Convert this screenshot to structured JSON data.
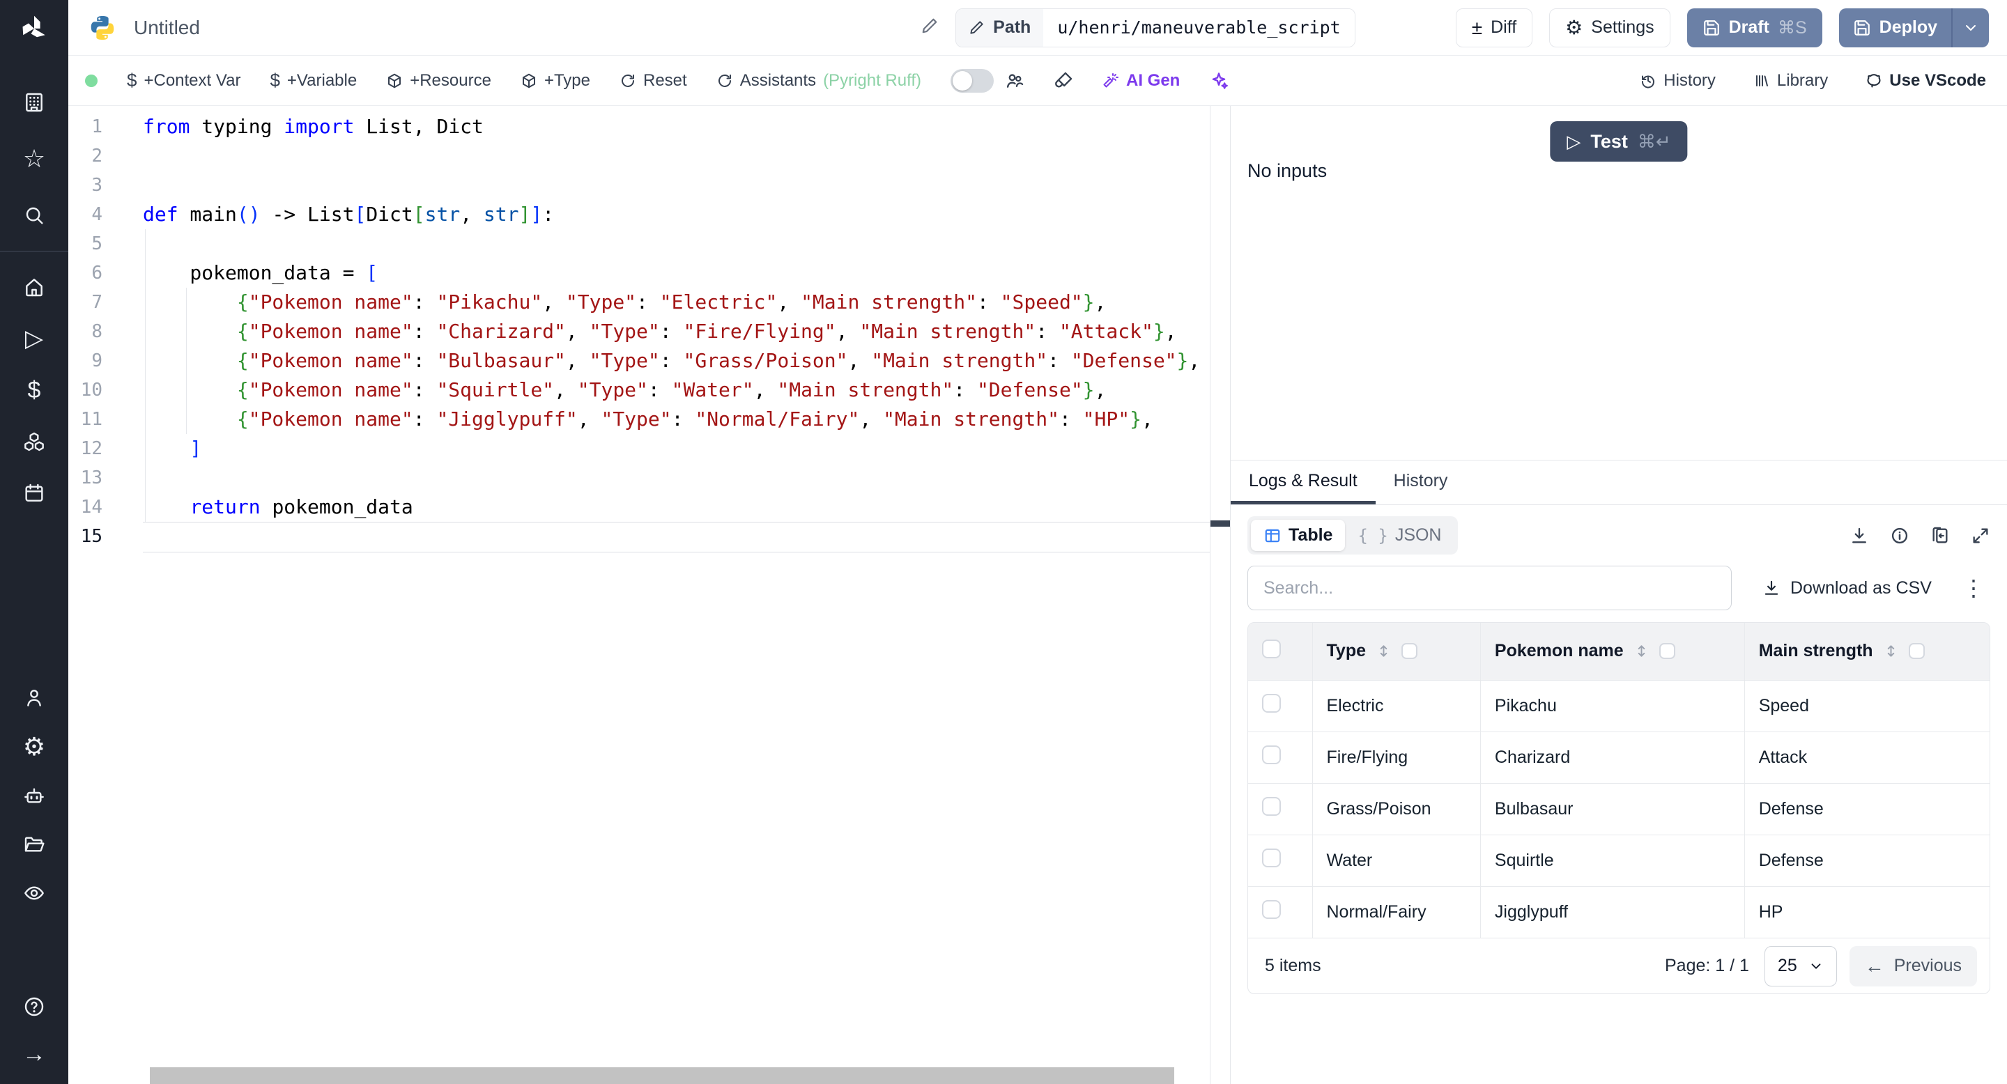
{
  "topbar": {
    "title": "Untitled",
    "path_label": "Path",
    "path_value": "u/henri/maneuverable_script",
    "diff_label": "Diff",
    "settings_label": "Settings",
    "draft_label": "Draft",
    "draft_shortcut": "⌘S",
    "deploy_label": "Deploy"
  },
  "toolbar": {
    "context_var": "+Context Var",
    "variable": "+Variable",
    "resource": "+Resource",
    "type": "+Type",
    "reset": "Reset",
    "assistants": "Assistants",
    "assistants_detail": "(Pyright Ruff)",
    "ai_gen": "AI Gen",
    "history": "History",
    "library": "Library",
    "vscode": "Use VScode"
  },
  "icons": {
    "plus_minus": "±",
    "gear": "⚙",
    "dollar": "$",
    "star": "☆",
    "play": "▷",
    "arrow_right": "→",
    "arrow_left": "←",
    "kebab": "⋮",
    "braces": "{ }",
    "cmd_enter": "⌘↵"
  },
  "editor": {
    "active_line": 15,
    "lines": [
      [
        [
          "kw",
          "from"
        ],
        [
          "pl",
          " typing "
        ],
        [
          "kw",
          "import"
        ],
        [
          "pl",
          " List, Dict"
        ]
      ],
      [],
      [],
      [
        [
          "kw",
          "def"
        ],
        [
          "pl",
          " main"
        ],
        [
          "b1",
          "()"
        ],
        [
          "pl",
          " -> List"
        ],
        [
          "b1",
          "["
        ],
        [
          "pl",
          "Dict"
        ],
        [
          "b2",
          "["
        ],
        [
          "ty",
          "str"
        ],
        [
          "pl",
          ", "
        ],
        [
          "ty",
          "str"
        ],
        [
          "b2",
          "]"
        ],
        [
          "b1",
          "]"
        ],
        [
          "pl",
          ":"
        ]
      ],
      [],
      [
        [
          "pl",
          "    pokemon_data = "
        ],
        [
          "b1",
          "["
        ]
      ],
      [
        [
          "pl",
          "        "
        ],
        [
          "b2",
          "{"
        ],
        [
          "st",
          "\"Pokemon name\""
        ],
        [
          "pl",
          ": "
        ],
        [
          "st",
          "\"Pikachu\""
        ],
        [
          "pl",
          ", "
        ],
        [
          "st",
          "\"Type\""
        ],
        [
          "pl",
          ": "
        ],
        [
          "st",
          "\"Electric\""
        ],
        [
          "pl",
          ", "
        ],
        [
          "st",
          "\"Main strength\""
        ],
        [
          "pl",
          ": "
        ],
        [
          "st",
          "\"Speed\""
        ],
        [
          "b2",
          "}"
        ],
        [
          "pl",
          ","
        ]
      ],
      [
        [
          "pl",
          "        "
        ],
        [
          "b2",
          "{"
        ],
        [
          "st",
          "\"Pokemon name\""
        ],
        [
          "pl",
          ": "
        ],
        [
          "st",
          "\"Charizard\""
        ],
        [
          "pl",
          ", "
        ],
        [
          "st",
          "\"Type\""
        ],
        [
          "pl",
          ": "
        ],
        [
          "st",
          "\"Fire/Flying\""
        ],
        [
          "pl",
          ", "
        ],
        [
          "st",
          "\"Main strength\""
        ],
        [
          "pl",
          ": "
        ],
        [
          "st",
          "\"Attack\""
        ],
        [
          "b2",
          "}"
        ],
        [
          "pl",
          ","
        ]
      ],
      [
        [
          "pl",
          "        "
        ],
        [
          "b2",
          "{"
        ],
        [
          "st",
          "\"Pokemon name\""
        ],
        [
          "pl",
          ": "
        ],
        [
          "st",
          "\"Bulbasaur\""
        ],
        [
          "pl",
          ", "
        ],
        [
          "st",
          "\"Type\""
        ],
        [
          "pl",
          ": "
        ],
        [
          "st",
          "\"Grass/Poison\""
        ],
        [
          "pl",
          ", "
        ],
        [
          "st",
          "\"Main strength\""
        ],
        [
          "pl",
          ": "
        ],
        [
          "st",
          "\"Defense\""
        ],
        [
          "b2",
          "}"
        ],
        [
          "pl",
          ","
        ]
      ],
      [
        [
          "pl",
          "        "
        ],
        [
          "b2",
          "{"
        ],
        [
          "st",
          "\"Pokemon name\""
        ],
        [
          "pl",
          ": "
        ],
        [
          "st",
          "\"Squirtle\""
        ],
        [
          "pl",
          ", "
        ],
        [
          "st",
          "\"Type\""
        ],
        [
          "pl",
          ": "
        ],
        [
          "st",
          "\"Water\""
        ],
        [
          "pl",
          ", "
        ],
        [
          "st",
          "\"Main strength\""
        ],
        [
          "pl",
          ": "
        ],
        [
          "st",
          "\"Defense\""
        ],
        [
          "b2",
          "}"
        ],
        [
          "pl",
          ","
        ]
      ],
      [
        [
          "pl",
          "        "
        ],
        [
          "b2",
          "{"
        ],
        [
          "st",
          "\"Pokemon name\""
        ],
        [
          "pl",
          ": "
        ],
        [
          "st",
          "\"Jigglypuff\""
        ],
        [
          "pl",
          ", "
        ],
        [
          "st",
          "\"Type\""
        ],
        [
          "pl",
          ": "
        ],
        [
          "st",
          "\"Normal/Fairy\""
        ],
        [
          "pl",
          ", "
        ],
        [
          "st",
          "\"Main strength\""
        ],
        [
          "pl",
          ": "
        ],
        [
          "st",
          "\"HP\""
        ],
        [
          "b2",
          "}"
        ],
        [
          "pl",
          ","
        ]
      ],
      [
        [
          "pl",
          "    "
        ],
        [
          "b1",
          "]"
        ]
      ],
      [],
      [
        [
          "pl",
          "    "
        ],
        [
          "kw",
          "return"
        ],
        [
          "pl",
          " pokemon_data"
        ]
      ],
      []
    ]
  },
  "run": {
    "test_label": "Test",
    "test_shortcut": "⌘↵",
    "no_inputs": "No inputs"
  },
  "result_panel": {
    "tabs": {
      "logs": "Logs & Result",
      "history": "History"
    },
    "view_toggle": {
      "table": "Table",
      "json": "JSON"
    },
    "search_placeholder": "Search...",
    "download_csv": "Download as CSV",
    "table": {
      "columns": [
        "Type",
        "Pokemon name",
        "Main strength"
      ],
      "rows": [
        [
          "Electric",
          "Pikachu",
          "Speed"
        ],
        [
          "Fire/Flying",
          "Charizard",
          "Attack"
        ],
        [
          "Grass/Poison",
          "Bulbasaur",
          "Defense"
        ],
        [
          "Water",
          "Squirtle",
          "Defense"
        ],
        [
          "Normal/Fairy",
          "Jigglypuff",
          "HP"
        ]
      ]
    },
    "footer": {
      "items": "5 items",
      "page": "Page: 1 / 1",
      "page_size": "25",
      "previous": "Previous"
    }
  },
  "colors": {
    "accent_slate": "#6b80a6",
    "test_navy": "#3e4b64",
    "green_status": "#7fdd9f",
    "assistant_green": "#8cd2a6",
    "ai_purple": "#7c3aed",
    "table_icon_blue": "#3b82f6",
    "sidebar_bg": "#1f242e"
  }
}
